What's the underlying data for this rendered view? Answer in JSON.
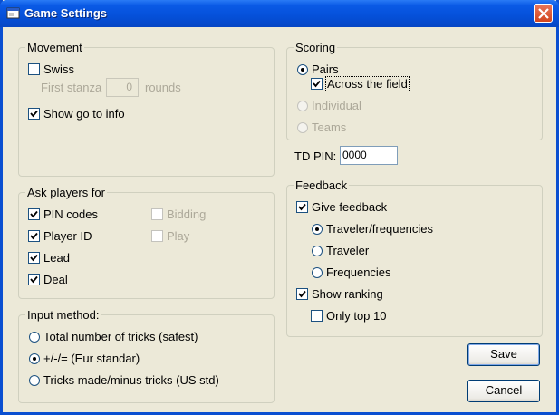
{
  "window": {
    "title": "Game Settings"
  },
  "movement": {
    "legend": "Movement",
    "swiss": {
      "label": "Swiss",
      "checked": false
    },
    "first_stanza": {
      "label": "First stanza",
      "value": "0",
      "suffix": "rounds"
    },
    "show_go_to_info": {
      "label": "Show go to info",
      "checked": true
    }
  },
  "scoring": {
    "legend": "Scoring",
    "pairs": {
      "label": "Pairs",
      "selected": true
    },
    "across_the_field": {
      "label": "Across the field",
      "checked": true
    },
    "individual": {
      "label": "Individual",
      "selected": false
    },
    "teams": {
      "label": "Teams",
      "selected": false
    }
  },
  "td_pin": {
    "label": "TD PIN:",
    "value": "0000"
  },
  "ask_players": {
    "legend": "Ask players for",
    "pin_codes": {
      "label": "PIN codes",
      "checked": true
    },
    "player_id": {
      "label": "Player ID",
      "checked": true
    },
    "lead": {
      "label": "Lead",
      "checked": true
    },
    "deal": {
      "label": "Deal",
      "checked": true
    },
    "bidding": {
      "label": "Bidding",
      "checked": false
    },
    "play": {
      "label": "Play",
      "checked": false
    }
  },
  "feedback": {
    "legend": "Feedback",
    "give_feedback": {
      "label": "Give feedback",
      "checked": true
    },
    "traveler_frequencies": {
      "label": "Traveler/frequencies",
      "selected": true
    },
    "traveler": {
      "label": "Traveler",
      "selected": false
    },
    "frequencies": {
      "label": "Frequencies",
      "selected": false
    },
    "show_ranking": {
      "label": "Show ranking",
      "checked": true
    },
    "only_top_10": {
      "label": "Only top 10",
      "checked": false
    }
  },
  "input_method": {
    "legend": "Input method:",
    "total_tricks": {
      "label": "Total number of tricks (safest)",
      "selected": false
    },
    "plus_minus": {
      "label": "+/-/= (Eur standar)",
      "selected": true
    },
    "tricks_made": {
      "label": "Tricks made/minus tricks (US std)",
      "selected": false
    }
  },
  "buttons": {
    "save": "Save",
    "cancel": "Cancel"
  },
  "colors": {
    "titlebar": "#0550d9",
    "face": "#ece9d8",
    "close": "#d2451e"
  }
}
